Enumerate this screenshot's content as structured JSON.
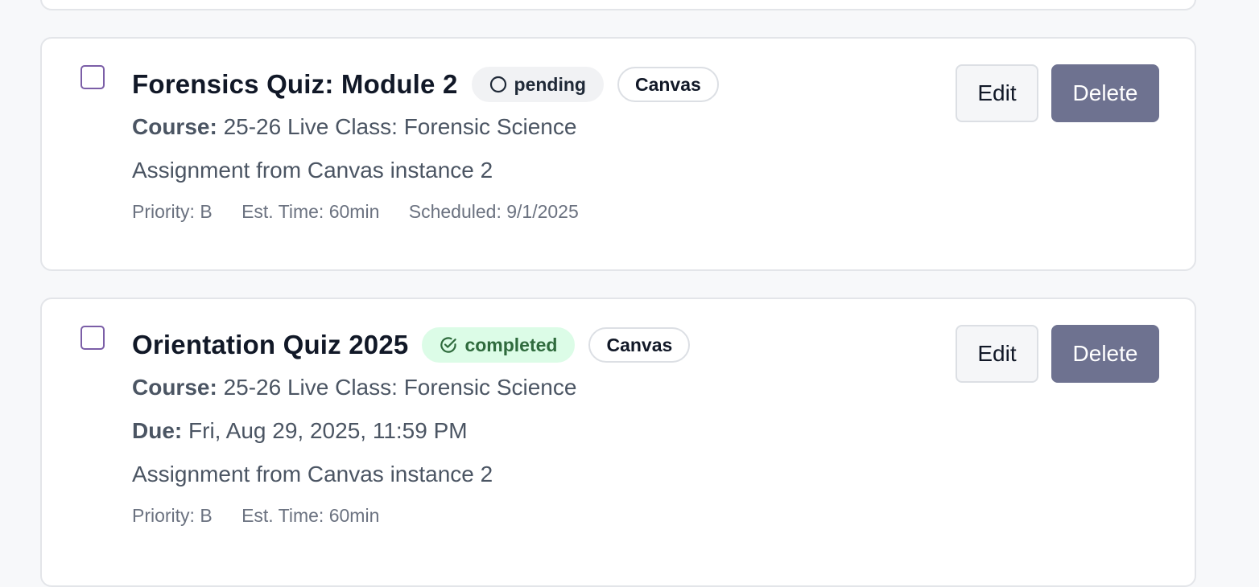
{
  "tasks": [
    {
      "title": "Forensics Quiz: Module 2",
      "status": "pending",
      "source": "Canvas",
      "course_label": "Course:",
      "course": "25-26 Live Class: Forensic Science",
      "description": "Assignment from Canvas instance 2",
      "priority": "Priority: B",
      "est_time": "Est. Time: 60min",
      "scheduled": "Scheduled: 9/1/2025",
      "status_icon": "circle-icon",
      "edit_label": "Edit",
      "delete_label": "Delete"
    },
    {
      "title": "Orientation Quiz 2025",
      "status": "completed",
      "source": "Canvas",
      "course_label": "Course:",
      "course": "25-26 Live Class: Forensic Science",
      "due_label": "Due:",
      "due": "Fri, Aug 29, 2025, 11:59 PM",
      "description": "Assignment from Canvas instance 2",
      "priority": "Priority: B",
      "est_time": "Est. Time: 60min",
      "status_icon": "check-circle-icon",
      "edit_label": "Edit",
      "delete_label": "Delete"
    }
  ],
  "colors": {
    "page_bg": "#f7f8fa",
    "checkbox_border": "#7b5ea7",
    "completed_bg": "#dcfce7",
    "completed_text": "#2f6b3d",
    "delete_bg": "#6e7290"
  }
}
